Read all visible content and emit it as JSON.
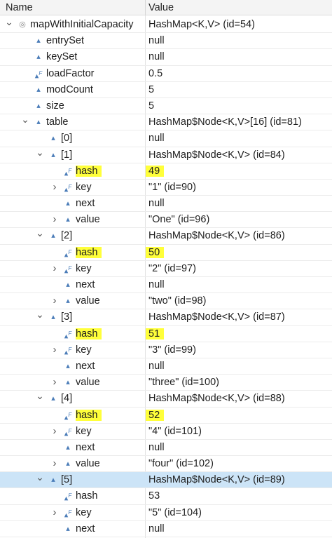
{
  "header": {
    "name": "Name",
    "value": "Value"
  },
  "rows": [
    {
      "indent": 0,
      "twisty": "open",
      "icon": "circle",
      "name": "mapWithInitialCapacity",
      "value": "HashMap<K,V>  (id=54)"
    },
    {
      "indent": 1,
      "twisty": "none",
      "icon": "triangle",
      "name": "entrySet",
      "value": "null"
    },
    {
      "indent": 1,
      "twisty": "none",
      "icon": "triangle",
      "name": "keySet",
      "value": "null"
    },
    {
      "indent": 1,
      "twisty": "none",
      "icon": "final",
      "name": "loadFactor",
      "value": "0.5"
    },
    {
      "indent": 1,
      "twisty": "none",
      "icon": "triangle",
      "name": "modCount",
      "value": "5"
    },
    {
      "indent": 1,
      "twisty": "none",
      "icon": "triangle",
      "name": "size",
      "value": "5"
    },
    {
      "indent": 1,
      "twisty": "open",
      "icon": "triangle",
      "name": "table",
      "value": "HashMap$Node<K,V>[16]  (id=81)"
    },
    {
      "indent": 2,
      "twisty": "none",
      "icon": "triangle",
      "name": "[0]",
      "value": "null"
    },
    {
      "indent": 2,
      "twisty": "open",
      "icon": "triangle",
      "name": "[1]",
      "value": "HashMap$Node<K,V>  (id=84)"
    },
    {
      "indent": 3,
      "twisty": "none",
      "icon": "final",
      "name": "hash",
      "value": "49",
      "highlight": true
    },
    {
      "indent": 3,
      "twisty": "closed",
      "icon": "final",
      "name": "key",
      "value": "\"1\" (id=90)"
    },
    {
      "indent": 3,
      "twisty": "none",
      "icon": "triangle",
      "name": "next",
      "value": "null"
    },
    {
      "indent": 3,
      "twisty": "closed",
      "icon": "triangle",
      "name": "value",
      "value": "\"One\" (id=96)"
    },
    {
      "indent": 2,
      "twisty": "open",
      "icon": "triangle",
      "name": "[2]",
      "value": "HashMap$Node<K,V>  (id=86)"
    },
    {
      "indent": 3,
      "twisty": "none",
      "icon": "final",
      "name": "hash",
      "value": "50",
      "highlight": true
    },
    {
      "indent": 3,
      "twisty": "closed",
      "icon": "final",
      "name": "key",
      "value": "\"2\" (id=97)"
    },
    {
      "indent": 3,
      "twisty": "none",
      "icon": "triangle",
      "name": "next",
      "value": "null"
    },
    {
      "indent": 3,
      "twisty": "closed",
      "icon": "triangle",
      "name": "value",
      "value": "\"two\" (id=98)"
    },
    {
      "indent": 2,
      "twisty": "open",
      "icon": "triangle",
      "name": "[3]",
      "value": "HashMap$Node<K,V>  (id=87)"
    },
    {
      "indent": 3,
      "twisty": "none",
      "icon": "final",
      "name": "hash",
      "value": "51",
      "highlight": true
    },
    {
      "indent": 3,
      "twisty": "closed",
      "icon": "final",
      "name": "key",
      "value": "\"3\" (id=99)"
    },
    {
      "indent": 3,
      "twisty": "none",
      "icon": "triangle",
      "name": "next",
      "value": "null"
    },
    {
      "indent": 3,
      "twisty": "closed",
      "icon": "triangle",
      "name": "value",
      "value": "\"three\" (id=100)"
    },
    {
      "indent": 2,
      "twisty": "open",
      "icon": "triangle",
      "name": "[4]",
      "value": "HashMap$Node<K,V>  (id=88)"
    },
    {
      "indent": 3,
      "twisty": "none",
      "icon": "final",
      "name": "hash",
      "value": "52",
      "highlight": true
    },
    {
      "indent": 3,
      "twisty": "closed",
      "icon": "final",
      "name": "key",
      "value": "\"4\" (id=101)"
    },
    {
      "indent": 3,
      "twisty": "none",
      "icon": "triangle",
      "name": "next",
      "value": "null"
    },
    {
      "indent": 3,
      "twisty": "closed",
      "icon": "triangle",
      "name": "value",
      "value": "\"four\" (id=102)"
    },
    {
      "indent": 2,
      "twisty": "open",
      "icon": "triangle",
      "name": "[5]",
      "value": "HashMap$Node<K,V>  (id=89)",
      "selected": true
    },
    {
      "indent": 3,
      "twisty": "none",
      "icon": "final",
      "name": "hash",
      "value": "53"
    },
    {
      "indent": 3,
      "twisty": "closed",
      "icon": "final",
      "name": "key",
      "value": "\"5\" (id=104)"
    },
    {
      "indent": 3,
      "twisty": "none",
      "icon": "triangle",
      "name": "next",
      "value": "null"
    }
  ],
  "colors": {
    "highlight": "#ffff3a",
    "selected_row": "#cce4f7",
    "field_icon": "#4a7cb8"
  }
}
